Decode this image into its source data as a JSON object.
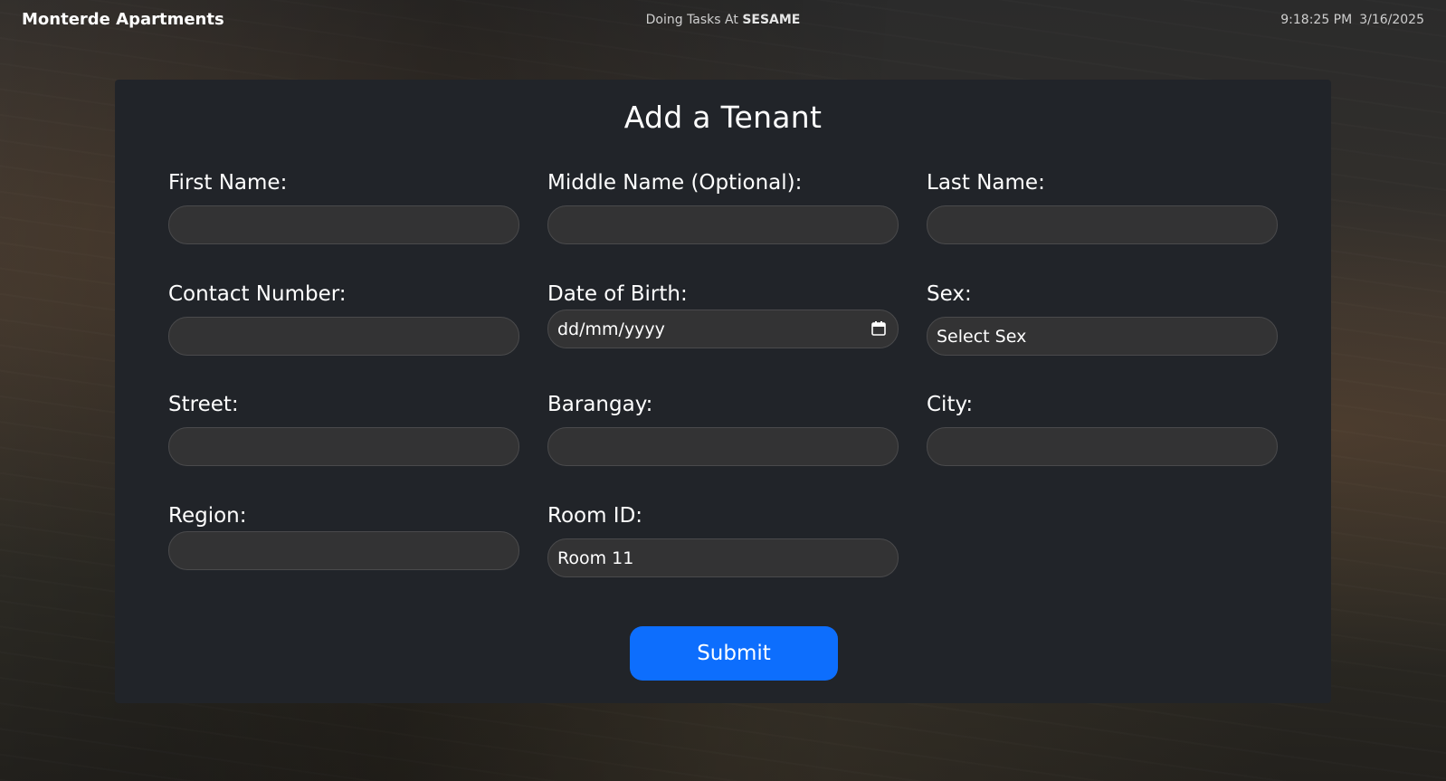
{
  "header": {
    "brand": "Monterde Apartments",
    "status_prefix": "Doing Tasks At",
    "status_org": "SESAME",
    "time": "9:18:25 PM",
    "date": "3/16/2025"
  },
  "form": {
    "title": "Add a Tenant",
    "fields": {
      "first_name": {
        "label": "First Name:",
        "value": ""
      },
      "middle_name": {
        "label": "Middle Name (Optional):",
        "value": ""
      },
      "last_name": {
        "label": "Last Name:",
        "value": ""
      },
      "contact_number": {
        "label": "Contact Number:",
        "value": ""
      },
      "date_of_birth": {
        "label": "Date of Birth:",
        "placeholder": "dd/mm/yyyy"
      },
      "sex": {
        "label": "Sex:",
        "selected": "Select Sex"
      },
      "street": {
        "label": "Street:",
        "value": ""
      },
      "barangay": {
        "label": "Barangay:",
        "value": ""
      },
      "city": {
        "label": "City:",
        "value": ""
      },
      "region": {
        "label": "Region:",
        "value": ""
      },
      "room_id": {
        "label": "Room ID:",
        "selected": "Room 11"
      }
    },
    "submit_label": "Submit"
  },
  "colors": {
    "card_bg": "#212429",
    "input_bg": "#333334",
    "accent": "#0d6efd"
  }
}
